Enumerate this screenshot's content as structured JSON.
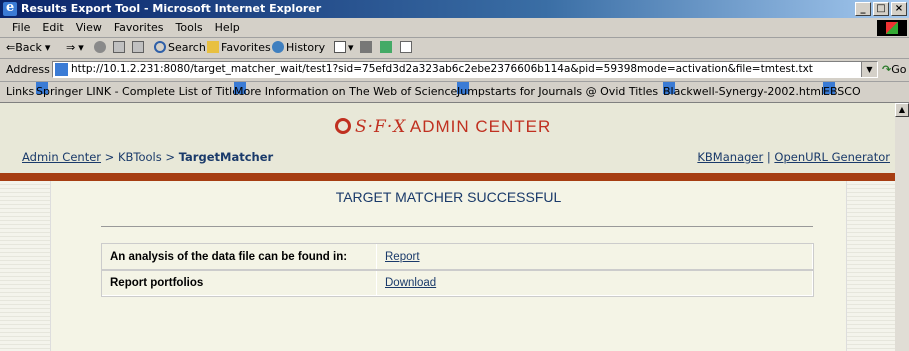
{
  "window": {
    "title": "Results Export Tool - Microsoft Internet Explorer",
    "controls": [
      "_",
      "□",
      "×"
    ]
  },
  "menu": [
    "File",
    "Edit",
    "View",
    "Favorites",
    "Tools",
    "Help"
  ],
  "toolbar": {
    "back": "⇐Back",
    "forward": "⇒",
    "search": "Search",
    "favorites": "Favorites",
    "history": "History"
  },
  "address": {
    "label": "Address",
    "url": "http://10.1.2.231:8080/target_matcher_wait/test1?sid=75efd3d2a323ab6c2ebe2376606b114a&pid=59398mode=activation&file=tmtest.txt",
    "go": "Go"
  },
  "links": {
    "label": "Links",
    "items": [
      "Springer LINK - Complete List of Titles",
      "More Information on The Web of Science",
      "Jumpstarts for Journals @ Ovid Titles",
      "Blackwell-Synergy-2002.html",
      "EBSCO"
    ]
  },
  "header": {
    "logo_sfx": "S·F·X",
    "logo_admin": "ADMIN CENTER",
    "breadcrumb": {
      "admin_center": "Admin Center",
      "sep1": ">",
      "kbtools": "KBTools",
      "sep2": ">",
      "current": "TargetMatcher"
    },
    "top_links": {
      "kbmanager": "KBManager",
      "divider": "|",
      "openurl": "OpenURL Generator"
    }
  },
  "main": {
    "heading": "TARGET MATCHER SUCCESSFUL",
    "rows": [
      {
        "label": "An analysis of the data file can be found in:",
        "link": "Report"
      },
      {
        "label": "Report portfolios",
        "link": "Download"
      }
    ]
  },
  "colors": {
    "brand": "#c03020",
    "brand_bar": "#a63d12",
    "link": "#1a3a6a"
  }
}
